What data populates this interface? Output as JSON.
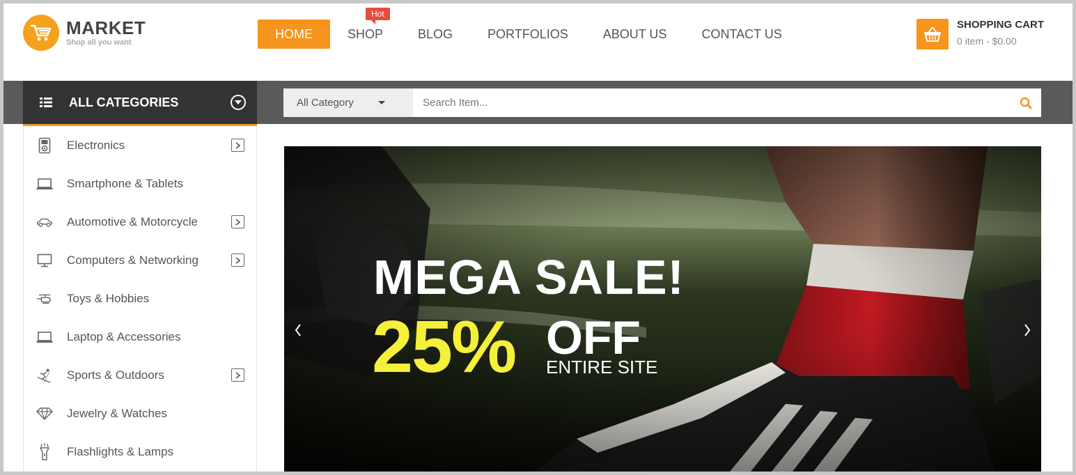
{
  "header": {
    "logo_title": "MARKET",
    "logo_subtitle": "Shop all you want",
    "nav": [
      {
        "label": "HOME",
        "active": true
      },
      {
        "label": "SHOP",
        "badge": "Hot"
      },
      {
        "label": "BLOG"
      },
      {
        "label": "PORTFOLIOS"
      },
      {
        "label": "ABOUT US"
      },
      {
        "label": "CONTACT US"
      }
    ],
    "cart": {
      "title": "SHOPPING CART",
      "summary": "0 item - $0.00"
    }
  },
  "categories_bar": {
    "title": "ALL CATEGORIES"
  },
  "search": {
    "category_selected": "All Category",
    "placeholder": "Search Item..."
  },
  "sidebar": {
    "items": [
      {
        "label": "Electronics",
        "icon": "ipod-icon",
        "has_submenu": true
      },
      {
        "label": "Smartphone & Tablets",
        "icon": "laptop-icon",
        "has_submenu": false
      },
      {
        "label": "Automotive & Motorcycle",
        "icon": "car-icon",
        "has_submenu": true
      },
      {
        "label": "Computers & Networking",
        "icon": "monitor-icon",
        "has_submenu": true
      },
      {
        "label": "Toys & Hobbies",
        "icon": "helicopter-icon",
        "has_submenu": false
      },
      {
        "label": "Laptop & Accessories",
        "icon": "laptop-icon",
        "has_submenu": false
      },
      {
        "label": "Sports & Outdoors",
        "icon": "skier-icon",
        "has_submenu": true
      },
      {
        "label": "Jewelry & Watches",
        "icon": "diamond-icon",
        "has_submenu": false
      },
      {
        "label": "Flashlights & Lamps",
        "icon": "flashlight-icon",
        "has_submenu": false
      }
    ]
  },
  "banner": {
    "headline": "MEGA SALE!",
    "percent": "25%",
    "off": "OFF",
    "subline": "ENTIRE SITE"
  },
  "colors": {
    "accent": "#f7941d",
    "dark_bar": "#5a5a5a",
    "category_header": "#333333",
    "hot_badge": "#e74c3c",
    "sale_yellow": "#f5f03a"
  }
}
